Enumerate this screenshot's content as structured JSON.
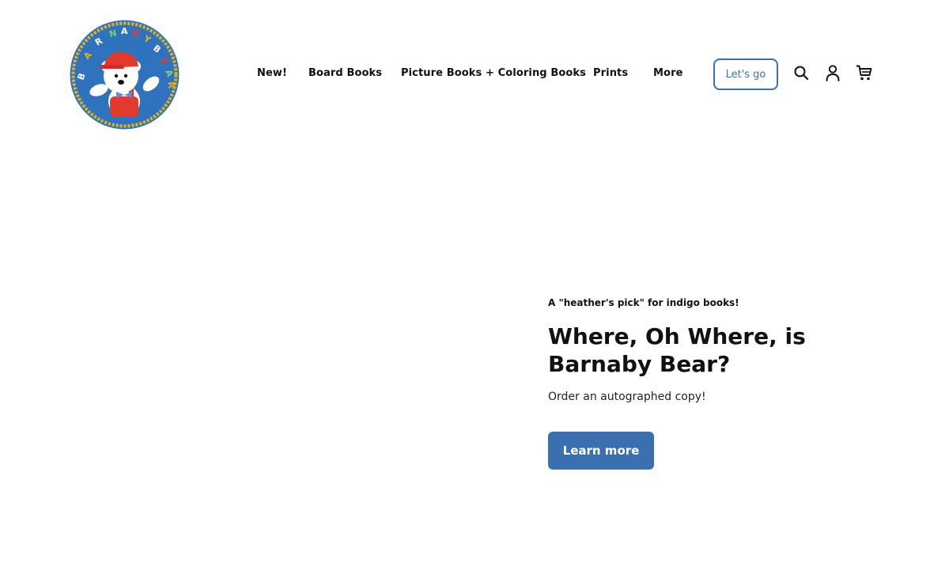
{
  "brand": {
    "logo_text": "BARNABY BEAR",
    "logo_colors": {
      "ring": "#2f73bf",
      "rope": "#e8b21a",
      "bear": "#ffffff",
      "hat": "#e23b2e"
    }
  },
  "nav": {
    "items": [
      {
        "label": "New!"
      },
      {
        "label": "Board Books"
      },
      {
        "label": "Picture Books + Coloring Books"
      },
      {
        "label": "Prints"
      },
      {
        "label": "More"
      }
    ]
  },
  "header_actions": {
    "cta_label": "Let's go",
    "icons": [
      "search-icon",
      "account-icon",
      "cart-icon"
    ]
  },
  "hero": {
    "eyebrow": "A \"heather's pick\" for indigo books!",
    "title": "Where, Oh Where, is Barnaby Bear?",
    "subtitle": "Order an autographed copy!",
    "button_label": "Learn more"
  },
  "colors": {
    "accent": "#3a6fb0",
    "text": "#111111"
  }
}
